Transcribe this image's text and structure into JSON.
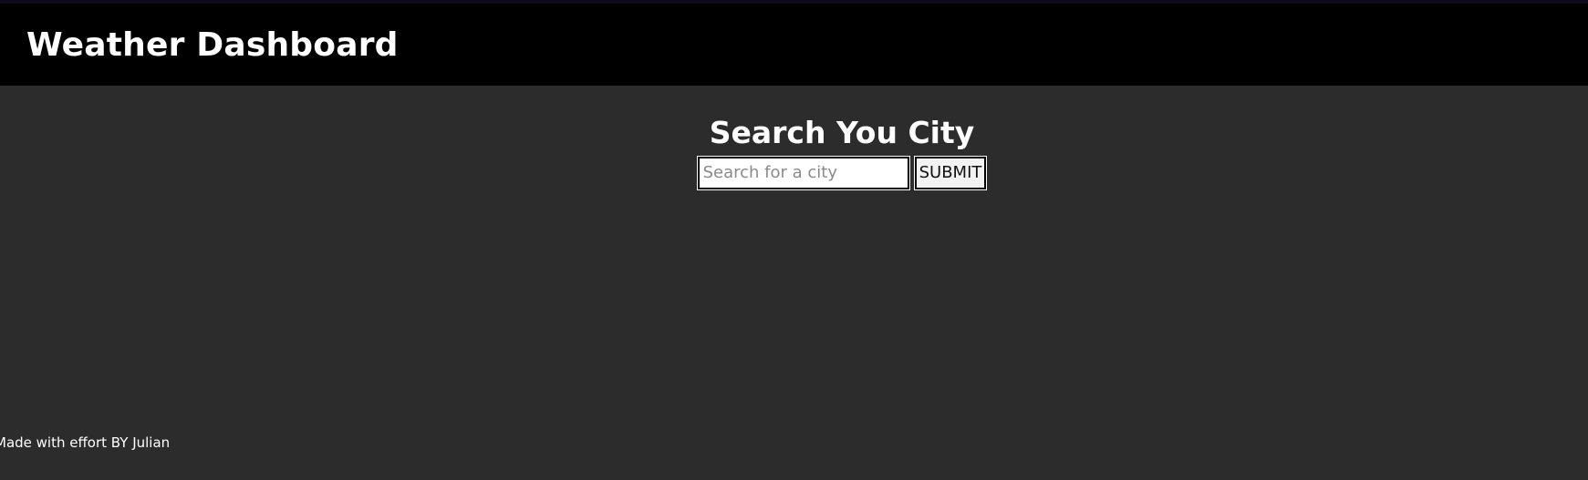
{
  "header": {
    "title": "Weather Dashboard"
  },
  "search": {
    "heading": "Search You City",
    "placeholder": "Search for a city",
    "value": "",
    "submit_label": "SUBMIT"
  },
  "footer": {
    "credit": "Made with effort BY Julian"
  },
  "colors": {
    "header_bg": "#000000",
    "page_bg": "#2c2c2c",
    "text": "#ffffff"
  }
}
